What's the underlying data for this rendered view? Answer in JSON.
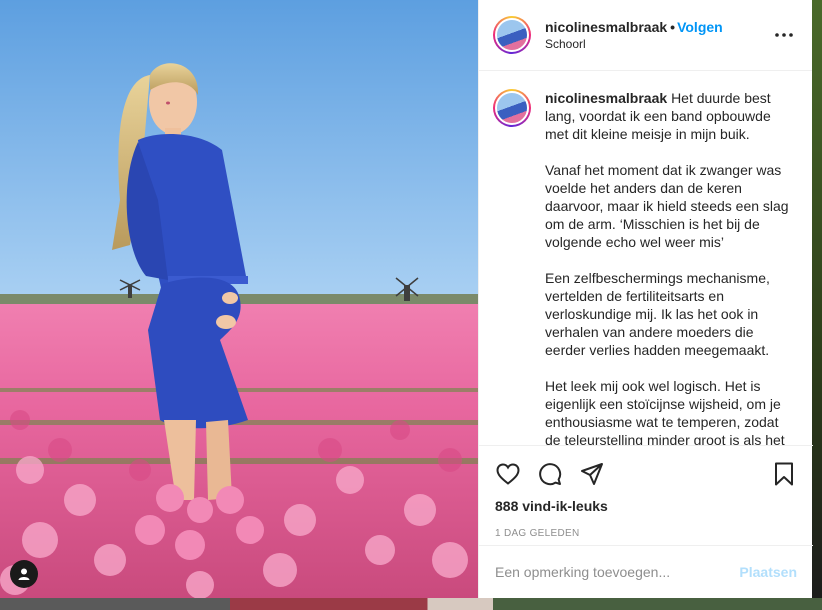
{
  "post": {
    "username": "nicolinesmalbraak",
    "separator": "•",
    "follow_label": "Volgen",
    "location": "Schoorl",
    "caption_paragraphs": [
      "Het duurde best lang, voordat ik een band opbouwde met dit kleine meisje in mijn buik.",
      "Vanaf het moment dat ik zwanger was voelde het anders dan de keren daarvoor, maar ik hield steeds een slag om de arm. ‘Misschien is het bij de volgende echo wel weer mis’",
      "Een zelfbeschermings mechanisme, vertelden de fertiliteitsarts en verloskundige mij. Ik las het ook in verhalen van andere moeders die eerder verlies hadden meegemaakt.",
      "Het leek mij ook wel logisch. Het is eigenlijk een stoïcijnse wijsheid, om je enthousiasme wat te temperen, zodat de teleurstelling minder groot is als het"
    ],
    "likes": "888 vind-ik-leuks",
    "timestamp": "1 DAG GELEDEN"
  },
  "comment": {
    "placeholder": "Een opmerking toevoegen...",
    "post_label": "Plaatsen"
  },
  "icons": {
    "more": "more-options-icon",
    "like": "heart-icon",
    "comment": "comment-icon",
    "share": "share-icon",
    "save": "bookmark-icon",
    "user_tag": "user-tag-icon"
  },
  "colors": {
    "link": "#0095f6",
    "post_disabled": "#b2dffc",
    "muted": "#8e8e8e",
    "text": "#262626"
  }
}
